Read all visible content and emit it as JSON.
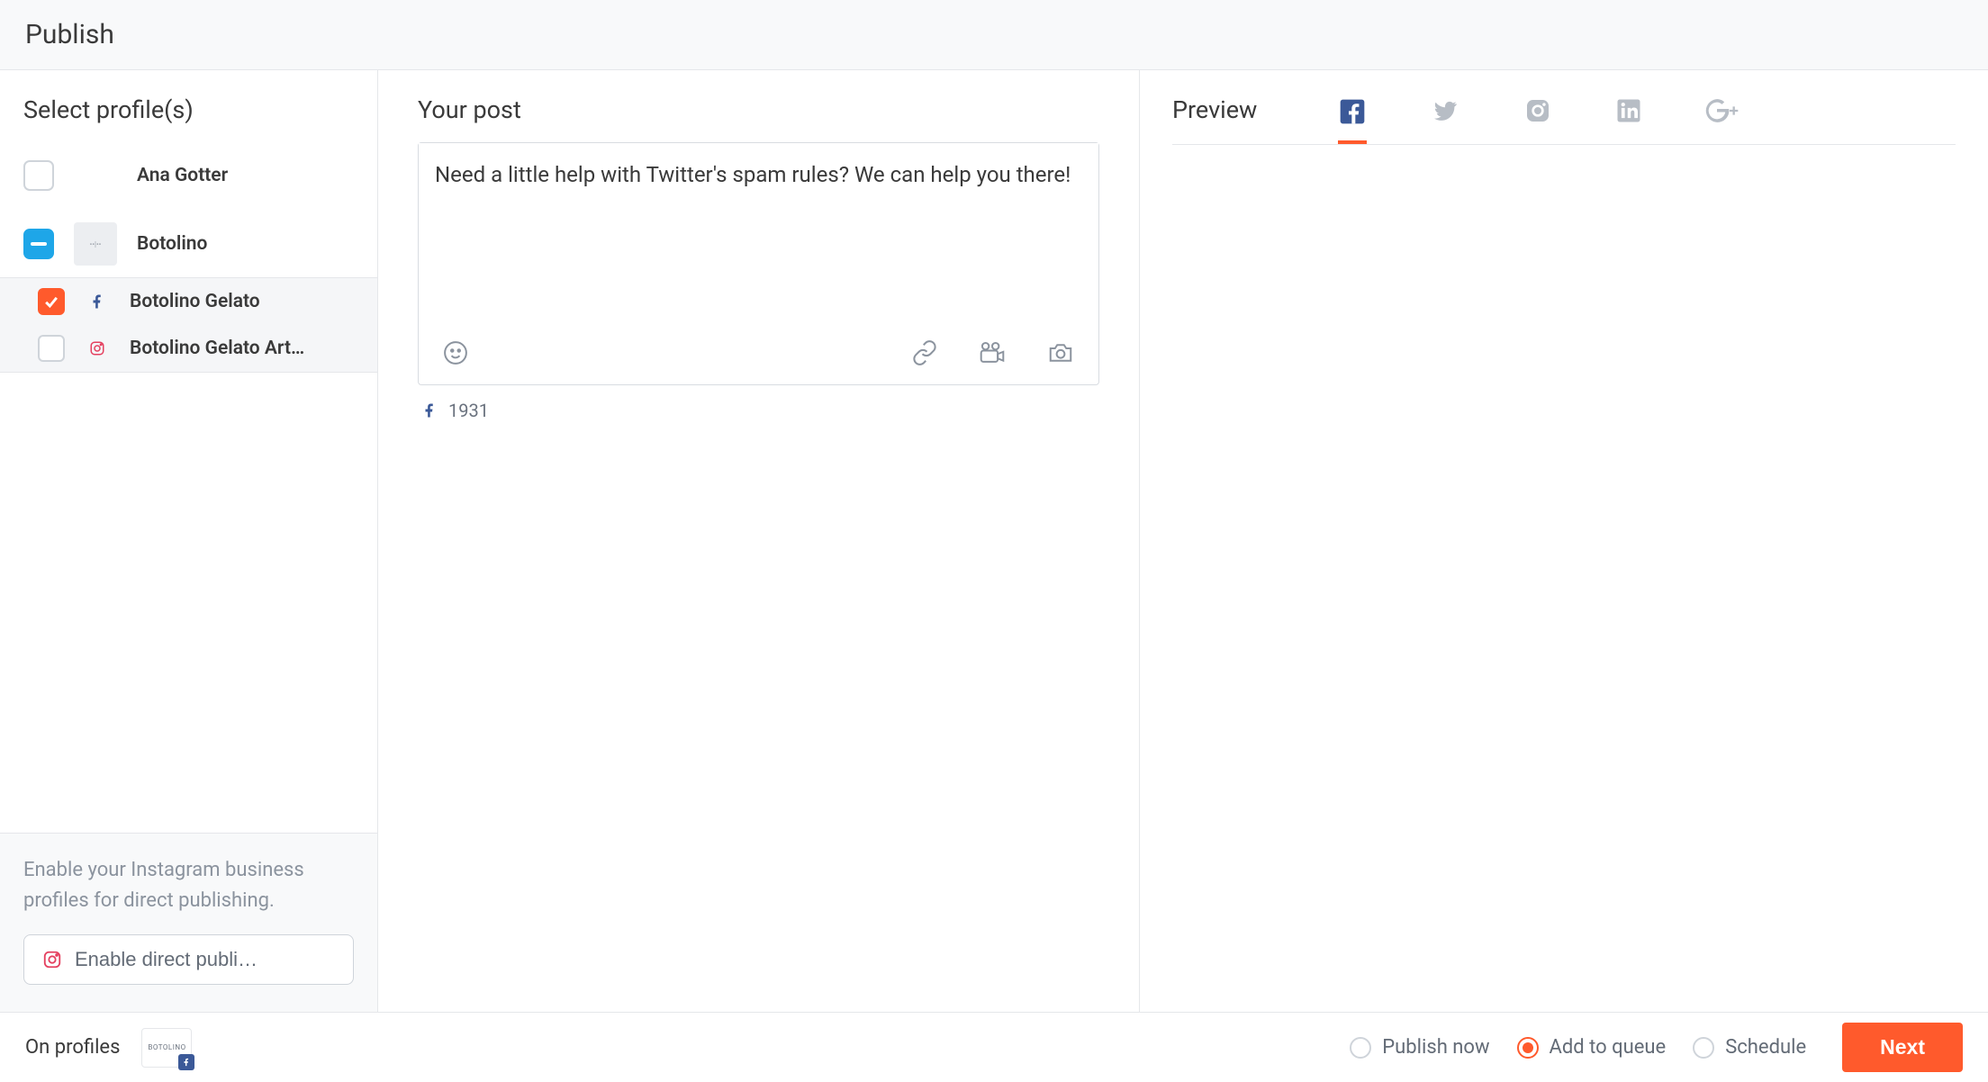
{
  "header": {
    "title": "Publish"
  },
  "sidebar": {
    "heading": "Select profile(s)",
    "profiles": [
      {
        "name": "Ana Gotter",
        "state": "unchecked"
      },
      {
        "name": "Botolino",
        "state": "partial"
      }
    ],
    "subProfiles": [
      {
        "name": "Botolino Gelato",
        "network": "facebook",
        "state": "checked"
      },
      {
        "name": "Botolino Gelato Art…",
        "network": "instagram",
        "state": "unchecked"
      }
    ],
    "hint": "Enable your Instagram business profiles for direct publishing.",
    "enableLabel": "Enable direct publi…"
  },
  "composer": {
    "heading": "Your post",
    "text": "Need a little help with Twitter's spam rules? We can help you there! ",
    "charCount": "1931",
    "charCountNetwork": "facebook"
  },
  "preview": {
    "title": "Preview",
    "tabs": [
      {
        "network": "facebook",
        "active": true
      },
      {
        "network": "twitter",
        "active": false
      },
      {
        "network": "instagram",
        "active": false
      },
      {
        "network": "linkedin",
        "active": false
      },
      {
        "network": "googleplus",
        "active": false
      }
    ]
  },
  "footer": {
    "onProfilesLabel": "On profiles",
    "selectedProfile": {
      "name": "BOTOLINO",
      "network": "facebook"
    },
    "publishOptions": [
      {
        "key": "now",
        "label": "Publish now",
        "selected": false
      },
      {
        "key": "queue",
        "label": "Add to queue",
        "selected": true
      },
      {
        "key": "schedule",
        "label": "Schedule",
        "selected": false
      }
    ],
    "nextLabel": "Next"
  },
  "colors": {
    "accent": "#ff5a2c",
    "facebook": "#3b5998",
    "twitter": "#b7bdc5",
    "muted": "#8b939e"
  }
}
